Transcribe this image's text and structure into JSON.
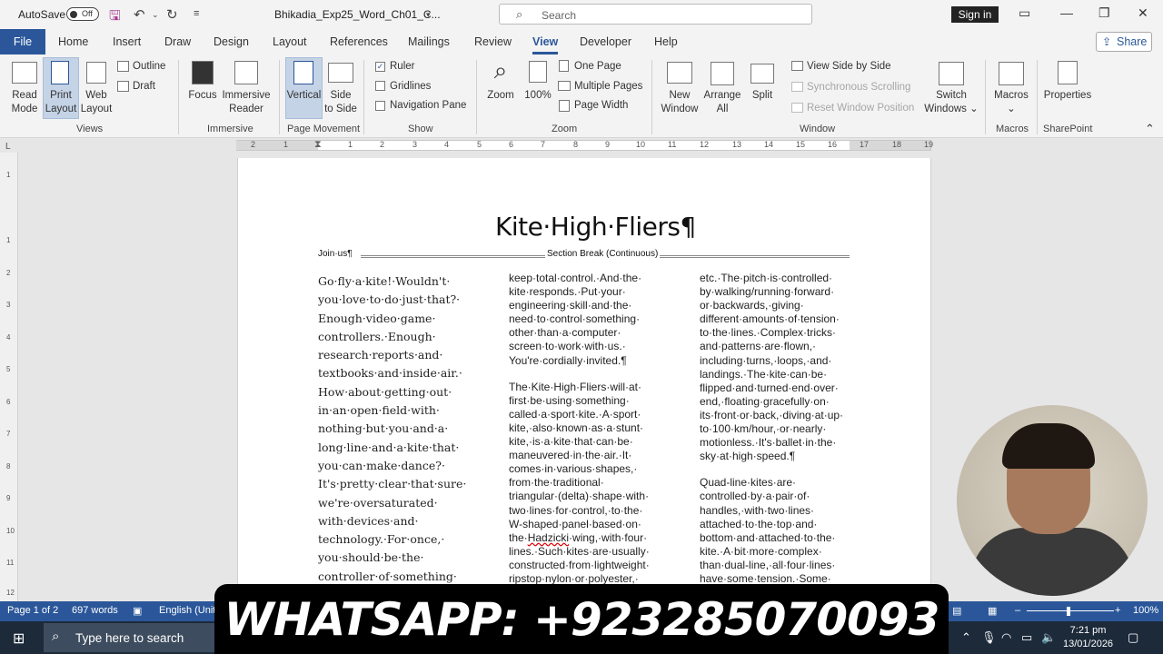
{
  "titlebar": {
    "autosave_label": "AutoSave",
    "autosave_state": "Off",
    "doc_title": "Bhikadia_Exp25_Word_Ch01_C...",
    "search_placeholder": "Search",
    "signin_label": "Sign in"
  },
  "tabs": {
    "file": "File",
    "home": "Home",
    "insert": "Insert",
    "draw": "Draw",
    "design": "Design",
    "layout": "Layout",
    "references": "References",
    "mailings": "Mailings",
    "review": "Review",
    "view": "View",
    "developer": "Developer",
    "help": "Help",
    "share": "Share"
  },
  "ribbon": {
    "views": {
      "read_mode_1": "Read",
      "read_mode_2": "Mode",
      "print_layout_1": "Print",
      "print_layout_2": "Layout",
      "web_layout_1": "Web",
      "web_layout_2": "Layout",
      "outline": "Outline",
      "draft": "Draft",
      "group": "Views"
    },
    "immersive": {
      "focus": "Focus",
      "immersive_reader_1": "Immersive",
      "immersive_reader_2": "Reader",
      "group": "Immersive"
    },
    "page_movement": {
      "vertical": "Vertical",
      "side_to_side_1": "Side",
      "side_to_side_2": "to Side",
      "group": "Page Movement"
    },
    "show": {
      "ruler": "Ruler",
      "gridlines": "Gridlines",
      "navigation_pane": "Navigation Pane",
      "ruler_checked": true,
      "group": "Show"
    },
    "zoom": {
      "zoom": "Zoom",
      "hundred": "100%",
      "one_page": "One Page",
      "multiple_pages": "Multiple Pages",
      "page_width": "Page Width",
      "group": "Zoom"
    },
    "window": {
      "new_window_1": "New",
      "new_window_2": "Window",
      "arrange_all_1": "Arrange",
      "arrange_all_2": "All",
      "split": "Split",
      "view_side_by_side": "View Side by Side",
      "synchronous_scrolling": "Synchronous Scrolling",
      "reset_window_position": "Reset Window Position",
      "switch_windows_1": "Switch",
      "switch_windows_2": "Windows",
      "group": "Window"
    },
    "macros": {
      "macros": "Macros",
      "group": "Macros"
    },
    "sharepoint": {
      "properties": "Properties",
      "group": "SharePoint"
    }
  },
  "ruler": {
    "ticks": [
      "2",
      "1",
      "1",
      "2",
      "3",
      "4",
      "5",
      "6",
      "7",
      "8",
      "9",
      "10",
      "11",
      "12",
      "13",
      "14",
      "15",
      "16",
      "17",
      "18",
      "19"
    ],
    "vticks": [
      "1",
      "1",
      "2",
      "3",
      "4",
      "5",
      "6",
      "7",
      "8",
      "9",
      "10",
      "11",
      "12"
    ]
  },
  "document": {
    "title": "Kite·High·Fliers¶",
    "join_us": "Join·us¶",
    "section_break": "Section Break (Continuous)",
    "col1": [
      "Go·fly·a·kite!·Wouldn't·",
      "you·love·to·do·just·that?·",
      "Enough·video·game·",
      "controllers.·Enough·",
      "research·reports·and·",
      "textbooks·and·inside·air.·",
      "How·about·getting·out·",
      "in·an·open·field·with·",
      "nothing·but·you·and·a·",
      "long·line·and·a·kite·that·",
      "you·can·make·dance?·",
      "It's·pretty·clear·that·sure·",
      "we're·oversaturated·",
      "with·devices·and·",
      "technology.·For·once,·",
      "you·should·be·the·",
      "controller·of·something·"
    ],
    "col2_p1": [
      "keep·total·control.·And·the·",
      "kite·responds.·Put·your·",
      "engineering·skill·and·the·",
      "need·to·control·something·",
      "other·than·a·computer·",
      "screen·to·work·with·us.·",
      "You're·cordially·invited.¶"
    ],
    "col2_p2": [
      "The·Kite·High·Fliers·will·at·",
      "first·be·using·something·",
      "called·a·sport·kite.·A·sport·",
      "kite,·also·known·as·a·stunt·",
      "kite,·is·a·kite·that·can·be·",
      "maneuvered·in·the·air.·It·",
      "comes·in·various·shapes,·",
      "from·the·traditional·",
      "triangular·(delta)·shape·with·",
      "two·lines·for·control,·to·the·",
      "W-shaped·panel·based·on·"
    ],
    "col2_hadzicki_pre": "the·",
    "col2_hadzicki": "Hadzicki",
    "col2_hadzicki_post": "·wing,·with·four·",
    "col2_p2_end": [
      "lines.·Such·kites·are·usually·",
      "constructed·from·lightweight·",
      "ripstop·nylon·or·polyester,·"
    ],
    "col3_p1": [
      "etc.·The·pitch·is·controlled·",
      "by·walking/running·forward·",
      "or·backwards,·giving·",
      "different·amounts·of·tension·",
      "to·the·lines.·Complex·tricks·",
      "and·patterns·are·flown,·",
      "including·turns,·loops,·and·",
      "landings.·The·kite·can·be·",
      "flipped·and·turned·end·over·",
      "end,·floating·gracefully·on·",
      "its·front·or·back,·diving·at·up·",
      "to·100·km/hour,·or·nearly·",
      "motionless.·It's·ballet·in·the·",
      "sky·at·high·speed.¶"
    ],
    "col3_p2": [
      "Quad-line·kites·are·",
      "controlled·by·a·pair·of·",
      "handles,·with·two·lines·",
      "attached·to·the·top·and·",
      "bottom·and·attached·to·the·",
      "kite.·A·bit·more·complex·",
      "than·dual-line,·all·four·lines·",
      "have·some·tension.·Some·"
    ]
  },
  "statusbar": {
    "page": "Page 1 of 2",
    "words": "697 words",
    "language": "English (Unit",
    "zoom": "100%"
  },
  "banner": {
    "text": "WHATSAPP: +923285070093"
  },
  "taskbar": {
    "search_placeholder": "Type here to search",
    "time": "7:21 pm",
    "date": "13/01/2026"
  },
  "colors": {
    "accent": "#2b579a",
    "ribbon_bg": "#f3f3f3",
    "status_bar": "#2b579a",
    "taskbar": "#1c2a3a"
  }
}
